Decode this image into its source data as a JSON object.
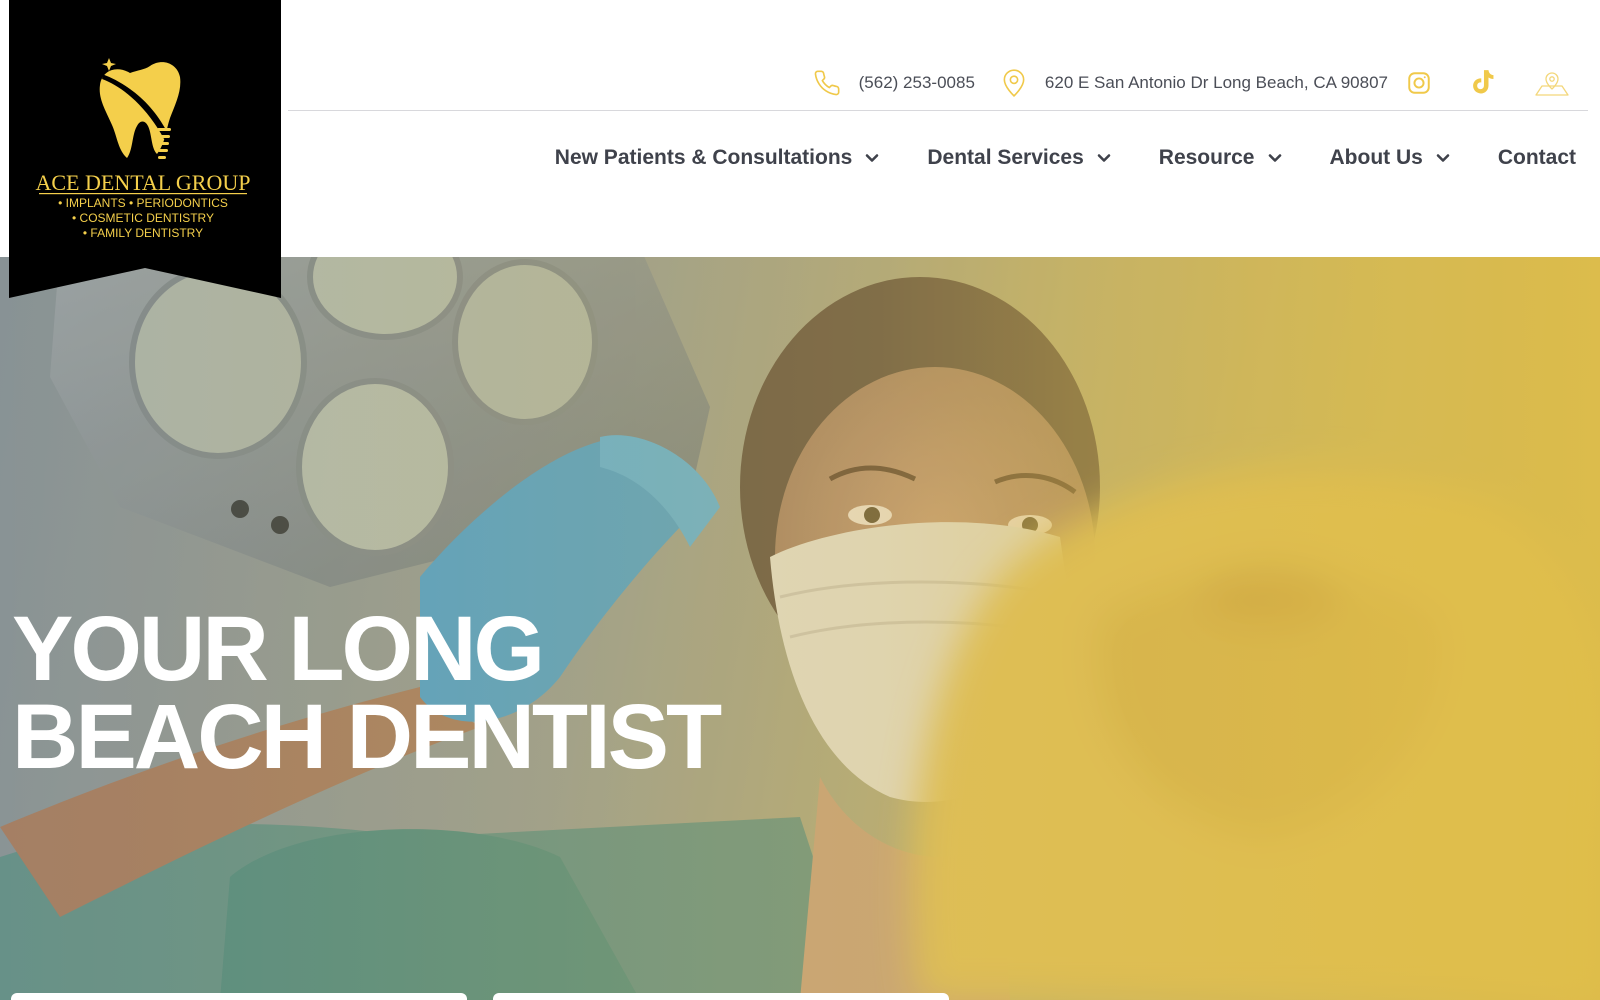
{
  "brand": {
    "name": "ACE DENTAL GROUP",
    "services_line1": "• IMPLANTS • PERIODONTICS",
    "services_line2": "• COSMETIC DENTISTRY",
    "services_line3": "• FAMILY DENTISTRY"
  },
  "contact": {
    "phone": "(562) 253-0085",
    "address": "620 E San Antonio Dr Long Beach, CA 90807",
    "icons": [
      "phone-icon",
      "location-pin-icon",
      "instagram-icon",
      "tiktok-icon",
      "map-icon"
    ]
  },
  "nav": {
    "items": [
      {
        "label": "New Patients & Consultations",
        "has_dropdown": true
      },
      {
        "label": "Dental Services",
        "has_dropdown": true
      },
      {
        "label": "Resource",
        "has_dropdown": true
      },
      {
        "label": "About Us",
        "has_dropdown": true
      },
      {
        "label": "Contact",
        "has_dropdown": false
      }
    ]
  },
  "hero": {
    "title_line1": "YOUR LONG",
    "title_line2": "BEACH DENTIST"
  },
  "colors": {
    "brand_yellow": "#f4cf4b",
    "logo_background": "#000000",
    "nav_text": "#3f424b",
    "hero_overlay": "#e6bf3a"
  }
}
